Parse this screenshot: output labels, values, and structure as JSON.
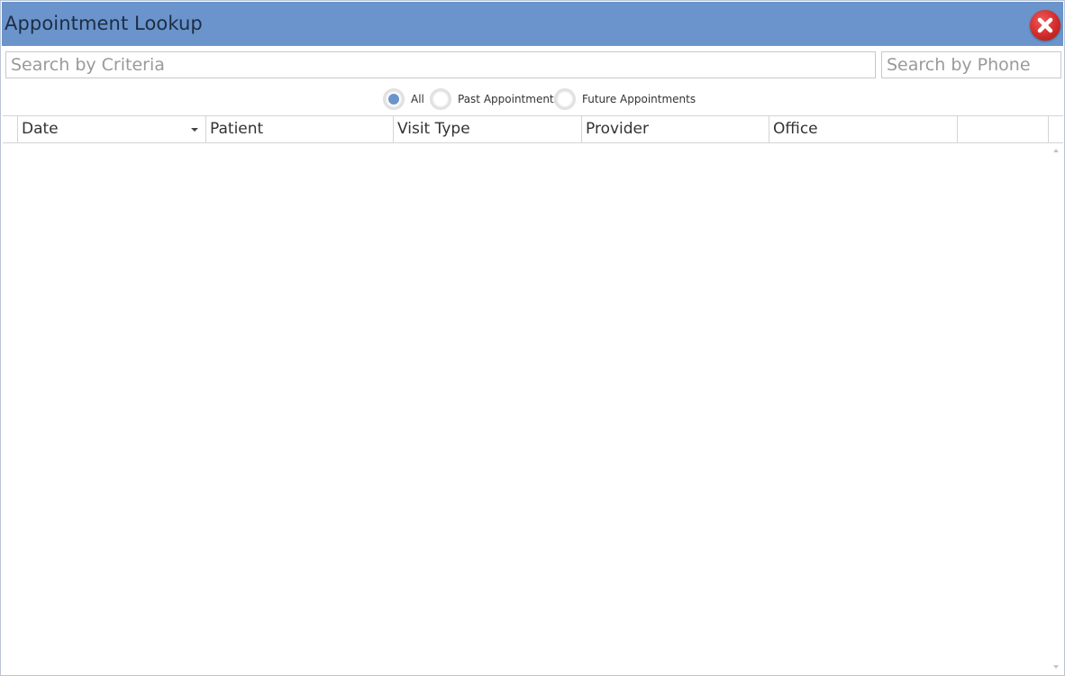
{
  "window": {
    "title": "Appointment Lookup",
    "accent_color": "#6a94cb",
    "close_icon": "close-icon"
  },
  "search": {
    "criteria_placeholder": "Search by Criteria",
    "criteria_value": "",
    "phone_placeholder": "Search by Phone",
    "phone_value": ""
  },
  "filter": {
    "options": [
      {
        "label": "All",
        "selected": true
      },
      {
        "label": "Past Appointments",
        "selected": false
      },
      {
        "label": "Future Appointments",
        "selected": false
      }
    ]
  },
  "grid": {
    "columns": [
      {
        "label": "Date",
        "sorted": "descending"
      },
      {
        "label": "Patient"
      },
      {
        "label": "Visit Type"
      },
      {
        "label": "Provider"
      },
      {
        "label": "Office"
      },
      {
        "label": ""
      }
    ],
    "rows": []
  }
}
